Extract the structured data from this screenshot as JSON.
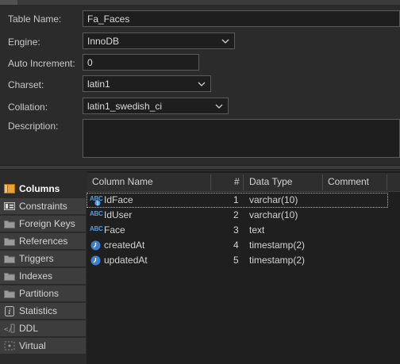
{
  "form": {
    "table_name_label": "Table Name:",
    "table_name_value": "Fa_Faces",
    "engine_label": "Engine:",
    "engine_value": "InnoDB",
    "auto_increment_label": "Auto Increment:",
    "auto_increment_value": "0",
    "charset_label": "Charset:",
    "charset_value": "latin1",
    "collation_label": "Collation:",
    "collation_value": "latin1_swedish_ci",
    "description_label": "Description:",
    "description_value": ""
  },
  "sidebar": {
    "items": [
      {
        "label": "Columns",
        "icon": "columns-icon",
        "active": true
      },
      {
        "label": "Constraints",
        "icon": "constraints-icon"
      },
      {
        "label": "Foreign Keys",
        "icon": "folder-icon"
      },
      {
        "label": "References",
        "icon": "folder-icon"
      },
      {
        "label": "Triggers",
        "icon": "folder-icon"
      },
      {
        "label": "Indexes",
        "icon": "folder-icon"
      },
      {
        "label": "Partitions",
        "icon": "folder-icon"
      },
      {
        "label": "Statistics",
        "icon": "info-icon"
      },
      {
        "label": "DDL",
        "icon": "ddl-icon"
      },
      {
        "label": "Virtual",
        "icon": "virtual-icon"
      }
    ]
  },
  "columns_grid": {
    "headers": {
      "name": "Column Name",
      "num": "#",
      "type": "Data Type",
      "comment": "Comment"
    },
    "rows": [
      {
        "name": "IdFace",
        "num": "1",
        "type": "varchar(10)",
        "icon": "text-key-icon",
        "selected": true
      },
      {
        "name": "IdUser",
        "num": "2",
        "type": "varchar(10)",
        "icon": "text-icon"
      },
      {
        "name": "Face",
        "num": "3",
        "type": "text",
        "icon": "text-icon"
      },
      {
        "name": "createdAt",
        "num": "4",
        "type": "timestamp(2)",
        "icon": "clock-icon"
      },
      {
        "name": "updatedAt",
        "num": "5",
        "type": "timestamp(2)",
        "icon": "clock-icon"
      }
    ]
  },
  "colors": {
    "accent": "#4f9de8",
    "background": "#2b2b2b",
    "field_bg": "#1e1e1e"
  }
}
